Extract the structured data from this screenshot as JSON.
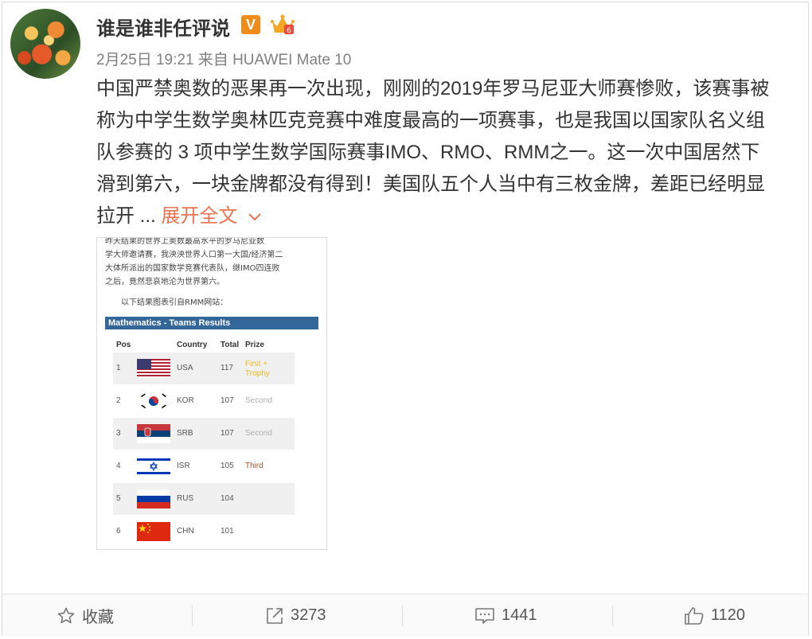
{
  "post": {
    "username": "谁是谁非任评说",
    "verified_badge": "V",
    "meta": "2月25日 19:21 来自 HUAWEI Mate 10",
    "content_lines": [
      "中国严禁奥数的恶果再一次出现，刚刚的2019年罗马尼亚大师赛惨败，该赛事被",
      "称为中学生数学奥林匹克竞赛中难度最高的一项赛事，也是我国以国家队名义组",
      "队参赛的 3 项中学生数学国际赛事IMO、RMO、RMM之一。这一次中国居然下",
      "滑到第六，一块金牌都没有得到！美国队五个人当中有三枚金牌，差距已经明显"
    ],
    "content_last": "拉开 ... ",
    "expand_label": "展开全文",
    "accent_color": "#eb7350"
  },
  "embedded_image": {
    "text_lines": [
      "昨天结果的世界上奥数最高水平的罗马尼亚数",
      "学大师邀请赛，我泱泱世界人口第一大国/经济第二",
      "大体所派出的国家数学竞赛代表队，继IMO四连败",
      "之后，竟然悲哀地沦为世界第六。"
    ],
    "note": "以下结果图表引自RMM网站：",
    "table_title": "Mathematics - Teams Results",
    "headers": [
      "Pos",
      "Country",
      "Total",
      "Prize"
    ],
    "rows": [
      {
        "pos": "1",
        "country": "USA",
        "total": "117",
        "prize_line1": "First +",
        "prize_line2": "Trophy",
        "prize_type": "gold",
        "flag": "usa"
      },
      {
        "pos": "2",
        "country": "KOR",
        "total": "107",
        "prize_line1": "Second",
        "prize_line2": "",
        "prize_type": "silver",
        "flag": "kor"
      },
      {
        "pos": "3",
        "country": "SRB",
        "total": "107",
        "prize_line1": "Second",
        "prize_line2": "",
        "prize_type": "silver",
        "flag": "srb"
      },
      {
        "pos": "4",
        "country": "ISR",
        "total": "105",
        "prize_line1": "Third",
        "prize_line2": "",
        "prize_type": "bronze",
        "flag": "isr"
      },
      {
        "pos": "5",
        "country": "RUS",
        "total": "104",
        "prize_line1": "",
        "prize_line2": "",
        "prize_type": "",
        "flag": "rus"
      },
      {
        "pos": "6",
        "country": "CHN",
        "total": "101",
        "prize_line1": "",
        "prize_line2": "",
        "prize_type": "",
        "flag": "chn"
      }
    ]
  },
  "actions": {
    "favorite": {
      "label": "收藏",
      "icon": "star-icon"
    },
    "repost": {
      "count": "3273",
      "icon": "repost-icon"
    },
    "comment": {
      "count": "1441",
      "icon": "comment-icon"
    },
    "like": {
      "count": "1120",
      "icon": "thumbs-up-icon"
    }
  }
}
